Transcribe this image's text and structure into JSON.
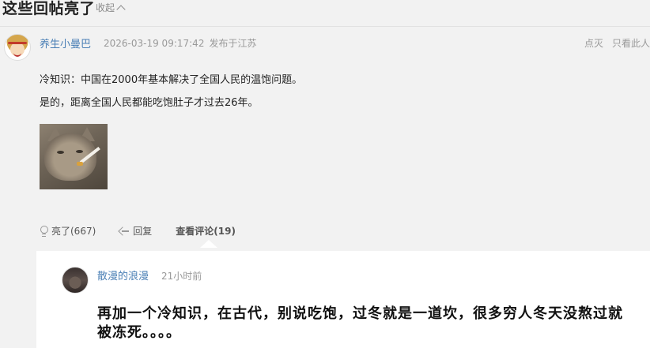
{
  "section": {
    "title": "这些回帖亮了",
    "collapse_label": "收起"
  },
  "post": {
    "username": "养生小曼巴",
    "timestamp": "2026-03-19 09:17:42",
    "location": "发布于江苏",
    "right_actions": [
      "点灭",
      "只看此人"
    ],
    "content_lines": [
      "冷知识：中国在2000年基本解决了全国人民的温饱问题。",
      "是的，距离全国人民都能吃饱肚子才过去26年。"
    ],
    "actions": {
      "light_label": "亮了(667)",
      "reply_label": "回复",
      "view_comments_label": "查看评论(19)"
    }
  },
  "reply": {
    "username": "散漫的浪漫",
    "time": "21小时前",
    "text": "再加一个冷知识，在古代，别说吃饱，过冬就是一道坎，很多穷人冬天没熬过就被冻死。。。。"
  }
}
